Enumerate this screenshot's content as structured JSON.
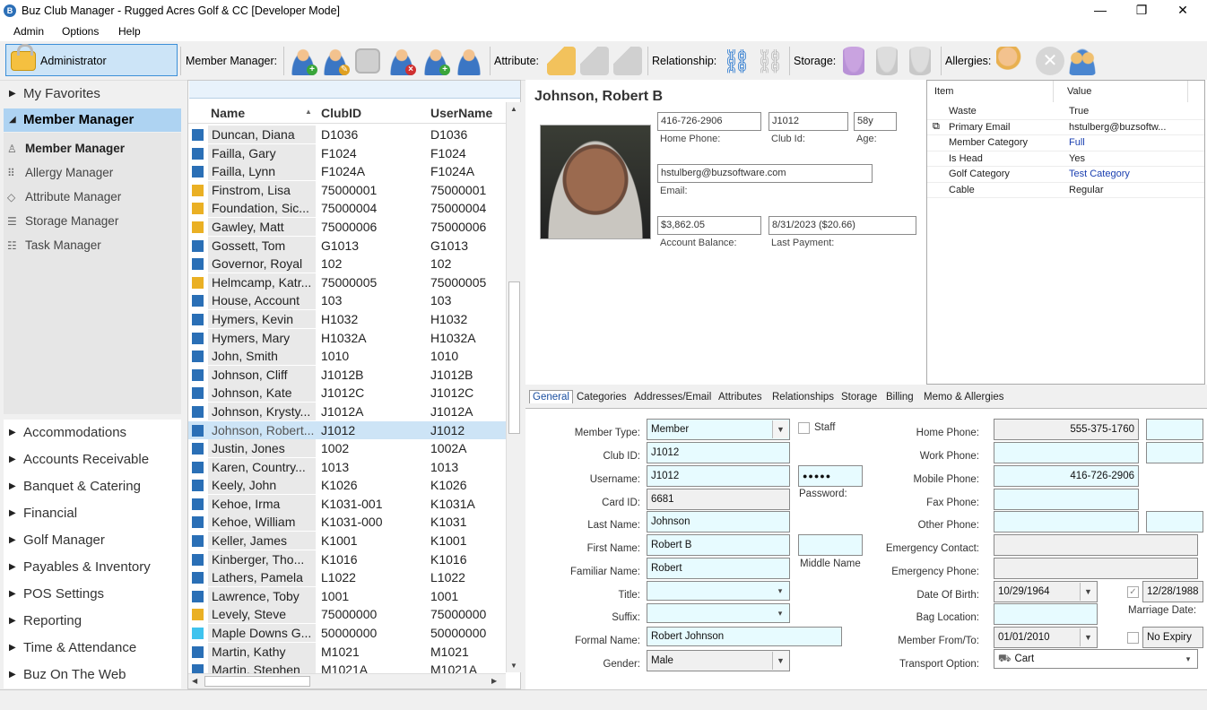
{
  "window": {
    "title": "Buz Club Manager - Rugged Acres Golf & CC [Developer Mode]"
  },
  "menu": [
    "Admin",
    "Options",
    "Help"
  ],
  "toolbar": {
    "admin_label": "Administrator",
    "member_manager_label": "Member Manager:",
    "attribute_label": "Attribute:",
    "relationship_label": "Relationship:",
    "storage_label": "Storage:",
    "allergies_label": "Allergies:"
  },
  "sidebar": {
    "favorites": "My Favorites",
    "member_manager": "Member Manager",
    "sub_items": [
      "Member Manager",
      "Allergy Manager",
      "Attribute Manager",
      "Storage Manager",
      "Task Manager"
    ],
    "modules": [
      "Accommodations",
      "Accounts Receivable",
      "Banquet & Catering",
      "Financial",
      "Golf Manager",
      "Payables & Inventory",
      "POS Settings",
      "Reporting",
      "Time & Attendance",
      "Buz On The Web"
    ]
  },
  "list": {
    "columns": [
      "Name",
      "ClubID",
      "UserName"
    ],
    "rows": [
      {
        "name": "Duncan, Diana",
        "club_id": "D1036",
        "username": "D1036",
        "color": "#2a6fb6"
      },
      {
        "name": "Failla, Gary",
        "club_id": "F1024",
        "username": "F1024",
        "color": "#2a6fb6"
      },
      {
        "name": "Failla, Lynn",
        "club_id": "F1024A",
        "username": "F1024A",
        "color": "#2a6fb6"
      },
      {
        "name": "Finstrom, Lisa",
        "club_id": "75000001",
        "username": "75000001",
        "color": "#eab024"
      },
      {
        "name": "Foundation,  Sic...",
        "club_id": "75000004",
        "username": "75000004",
        "color": "#eab024"
      },
      {
        "name": "Gawley, Matt",
        "club_id": "75000006",
        "username": "75000006",
        "color": "#eab024"
      },
      {
        "name": "Gossett, Tom",
        "club_id": "G1013",
        "username": "G1013",
        "color": "#2a6fb6"
      },
      {
        "name": "Governor, Royal",
        "club_id": "102",
        "username": "102",
        "color": "#2a6fb6"
      },
      {
        "name": "Helmcamp,  Katr...",
        "club_id": "75000005",
        "username": "75000005",
        "color": "#eab024"
      },
      {
        "name": "House, Account",
        "club_id": "103",
        "username": "103",
        "color": "#2a6fb6"
      },
      {
        "name": "Hymers, Kevin",
        "club_id": "H1032",
        "username": "H1032",
        "color": "#2a6fb6"
      },
      {
        "name": "Hymers, Mary",
        "club_id": "H1032A",
        "username": "H1032A",
        "color": "#2a6fb6"
      },
      {
        "name": "John, Smith",
        "club_id": "1010",
        "username": "1010",
        "color": "#2a6fb6"
      },
      {
        "name": "Johnson, Cliff",
        "club_id": "J1012B",
        "username": "J1012B",
        "color": "#2a6fb6"
      },
      {
        "name": "Johnson, Kate",
        "club_id": "J1012C",
        "username": "J1012C",
        "color": "#2a6fb6"
      },
      {
        "name": "Johnson,  Krysty...",
        "club_id": "J1012A",
        "username": "J1012A",
        "color": "#2a6fb6"
      },
      {
        "name": "Johnson,  Robert...",
        "club_id": "J1012",
        "username": "J1012",
        "color": "#2a6fb6",
        "selected": true
      },
      {
        "name": "Justin, Jones",
        "club_id": "1002",
        "username": "1002A",
        "color": "#2a6fb6"
      },
      {
        "name": "Karen,  Country...",
        "club_id": "1013",
        "username": "1013",
        "color": "#2a6fb6"
      },
      {
        "name": "Keely, John",
        "club_id": "K1026",
        "username": "K1026",
        "color": "#2a6fb6"
      },
      {
        "name": "Kehoe, Irma",
        "club_id": "K1031-001",
        "username": "K1031A",
        "color": "#2a6fb6"
      },
      {
        "name": "Kehoe, William",
        "club_id": "K1031-000",
        "username": "K1031",
        "color": "#2a6fb6"
      },
      {
        "name": "Keller, James",
        "club_id": "K1001",
        "username": "K1001",
        "color": "#2a6fb6"
      },
      {
        "name": "Kinberger,  Tho...",
        "club_id": "K1016",
        "username": "K1016",
        "color": "#2a6fb6"
      },
      {
        "name": "Lathers, Pamela",
        "club_id": "L1022",
        "username": "L1022",
        "color": "#2a6fb6"
      },
      {
        "name": "Lawrence, Toby",
        "club_id": "1001",
        "username": "1001",
        "color": "#2a6fb6"
      },
      {
        "name": "Levely, Steve",
        "club_id": "75000000",
        "username": "75000000",
        "color": "#eab024"
      },
      {
        "name": "Maple Downs  G...",
        "club_id": "50000000",
        "username": "50000000",
        "color": "#3fc3ee"
      },
      {
        "name": "Martin, Kathy",
        "club_id": "M1021",
        "username": "M1021",
        "color": "#2a6fb6"
      },
      {
        "name": "Martin, Stephen",
        "club_id": "M1021A",
        "username": "M1021A",
        "color": "#2a6fb6"
      }
    ]
  },
  "member": {
    "name": "Johnson, Robert B",
    "home_phone": "416-726-2906",
    "home_phone_label": "Home Phone:",
    "club_id": "J1012",
    "club_id_label": "Club Id:",
    "age": "58y",
    "age_label": "Age:",
    "email": "hstulberg@buzsoftware.com",
    "email_label": "Email:",
    "balance": "$3,862.05",
    "balance_label": "Account Balance:",
    "last_payment": "8/31/2023 ($20.66)",
    "last_payment_label": "Last Payment:"
  },
  "props": {
    "headers": [
      "Item",
      "Value"
    ],
    "rows": [
      {
        "k": "Waste",
        "v": "True",
        "c": "#222"
      },
      {
        "k": "Primary Email",
        "v": "hstulberg@buzsoftw...",
        "c": "#222"
      },
      {
        "k": "Member Category",
        "v": "Full",
        "c": "#1a3fb0"
      },
      {
        "k": "Is Head",
        "v": "Yes",
        "c": "#222"
      },
      {
        "k": "Golf Category",
        "v": "Test Category",
        "c": "#1a3fb0"
      },
      {
        "k": "Cable",
        "v": "Regular",
        "c": "#222"
      }
    ]
  },
  "tabs": [
    "General",
    "Categories",
    "Addresses/Email",
    "Attributes",
    "Relationships",
    "Storage",
    "Billing",
    "Memo & Allergies"
  ],
  "general": {
    "member_type_label": "Member Type:",
    "member_type": "Member",
    "staff_label": "Staff",
    "club_id_label": "Club ID:",
    "club_id": "J1012",
    "username_label": "Username:",
    "username": "J1012",
    "password": "●●●●●",
    "password_label": "Password:",
    "card_id_label": "Card ID:",
    "card_id": "6681",
    "last_name_label": "Last Name:",
    "last_name": "Johnson",
    "first_name_label": "First Name:",
    "first_name": "Robert B",
    "middle_name_label": "Middle Name",
    "familiar_name_label": "Familiar Name:",
    "familiar_name": "Robert",
    "title_label": "Title:",
    "suffix_label": "Suffix:",
    "formal_name_label": "Formal Name:",
    "formal_name": "Robert Johnson",
    "gender_label": "Gender:",
    "gender": "Male",
    "home_phone_label": "Home Phone:",
    "home_phone": "555-375-1760",
    "work_phone_label": "Work Phone:",
    "mobile_phone_label": "Mobile Phone:",
    "mobile_phone": "416-726-2906",
    "fax_phone_label": "Fax Phone:",
    "other_phone_label": "Other Phone:",
    "emergency_contact_label": "Emergency Contact:",
    "emergency_phone_label": "Emergency Phone:",
    "dob_label": "Date Of Birth:",
    "dob": "10/29/1964",
    "marriage_date": "12/28/1988",
    "marriage_date_label": "Marriage Date:",
    "bag_location_label": "Bag Location:",
    "member_from_label": "Member From/To:",
    "member_from": "01/01/2010",
    "no_expiry": "No Expiry",
    "transport_label": "Transport Option:",
    "transport": "Cart"
  }
}
